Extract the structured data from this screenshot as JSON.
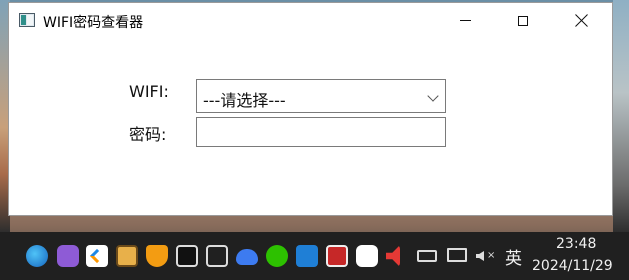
{
  "window": {
    "title": "WIFI密码查看器"
  },
  "form": {
    "wifi_label": "WIFI:",
    "wifi_select_value": "---请选择---",
    "password_label": "密码:",
    "password_value": ""
  },
  "taskbar": {
    "icons": [
      "network-globe-icon",
      "cat-app-icon",
      "arrow-app-icon",
      "window-app-icon",
      "shield-app-icon",
      "dolby-icon",
      "copy-window-icon",
      "cloud-icon",
      "wechat-icon",
      "browser-e-icon",
      "no-entry-app-icon",
      "drops-app-icon",
      "speaker-tray-icon",
      "battery-tray-icon",
      "network-tray-icon",
      "mute-tray-icon"
    ],
    "ime_label": "英",
    "time": "23:48",
    "date": "2024/11/29"
  }
}
